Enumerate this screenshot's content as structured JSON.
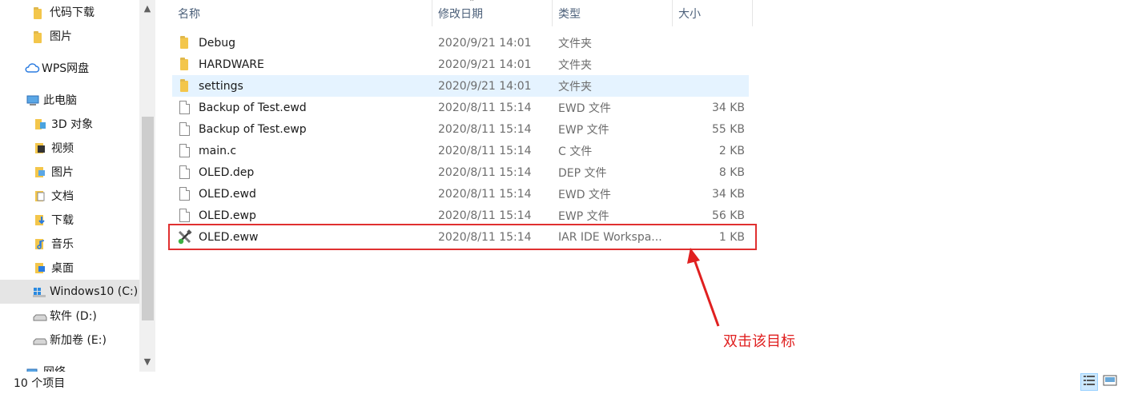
{
  "nav": {
    "items": [
      {
        "label": "代码下载",
        "icon": "folder-icon"
      },
      {
        "label": "图片",
        "icon": "folder-icon"
      },
      {
        "label": "WPS网盘",
        "icon": "cloud-icon"
      },
      {
        "label": "此电脑",
        "icon": "computer-icon"
      },
      {
        "label": "3D 对象",
        "icon": "3d-objects-icon"
      },
      {
        "label": "视频",
        "icon": "video-icon"
      },
      {
        "label": "图片",
        "icon": "pictures-icon"
      },
      {
        "label": "文档",
        "icon": "documents-icon"
      },
      {
        "label": "下载",
        "icon": "download-icon"
      },
      {
        "label": "音乐",
        "icon": "music-icon"
      },
      {
        "label": "桌面",
        "icon": "desktop-icon"
      },
      {
        "label": "Windows10 (C:)",
        "icon": "windows-drive-icon"
      },
      {
        "label": "软件 (D:)",
        "icon": "drive-icon"
      },
      {
        "label": "新加卷 (E:)",
        "icon": "drive-icon"
      },
      {
        "label": "网络",
        "icon": "network-icon"
      }
    ],
    "selected_index": 11
  },
  "columns": {
    "name": "名称",
    "date": "修改日期",
    "type": "类型",
    "size": "大小"
  },
  "files": [
    {
      "name": "Debug",
      "date": "2020/9/21 14:01",
      "type": "文件夹",
      "size": "",
      "icon": "folder-icon"
    },
    {
      "name": "HARDWARE",
      "date": "2020/9/21 14:01",
      "type": "文件夹",
      "size": "",
      "icon": "folder-icon"
    },
    {
      "name": "settings",
      "date": "2020/9/21 14:01",
      "type": "文件夹",
      "size": "",
      "icon": "folder-icon"
    },
    {
      "name": "Backup of Test.ewd",
      "date": "2020/8/11 15:14",
      "type": "EWD 文件",
      "size": "34 KB",
      "icon": "file-icon"
    },
    {
      "name": "Backup of Test.ewp",
      "date": "2020/8/11 15:14",
      "type": "EWP 文件",
      "size": "55 KB",
      "icon": "file-icon"
    },
    {
      "name": "main.c",
      "date": "2020/8/11 15:14",
      "type": "C 文件",
      "size": "2 KB",
      "icon": "file-icon"
    },
    {
      "name": "OLED.dep",
      "date": "2020/8/11 15:14",
      "type": "DEP 文件",
      "size": "8 KB",
      "icon": "file-icon"
    },
    {
      "name": "OLED.ewd",
      "date": "2020/8/11 15:14",
      "type": "EWD 文件",
      "size": "34 KB",
      "icon": "file-icon"
    },
    {
      "name": "OLED.ewp",
      "date": "2020/8/11 15:14",
      "type": "EWP 文件",
      "size": "56 KB",
      "icon": "file-icon"
    },
    {
      "name": "OLED.eww",
      "date": "2020/8/11 15:14",
      "type": "IAR IDE Workspa...",
      "size": "1 KB",
      "icon": "iar-workspace-icon"
    }
  ],
  "hover_row_index": 2,
  "annotation": {
    "text": "双击该目标",
    "color": "#e02020"
  },
  "status": {
    "count": "10 个项目"
  }
}
